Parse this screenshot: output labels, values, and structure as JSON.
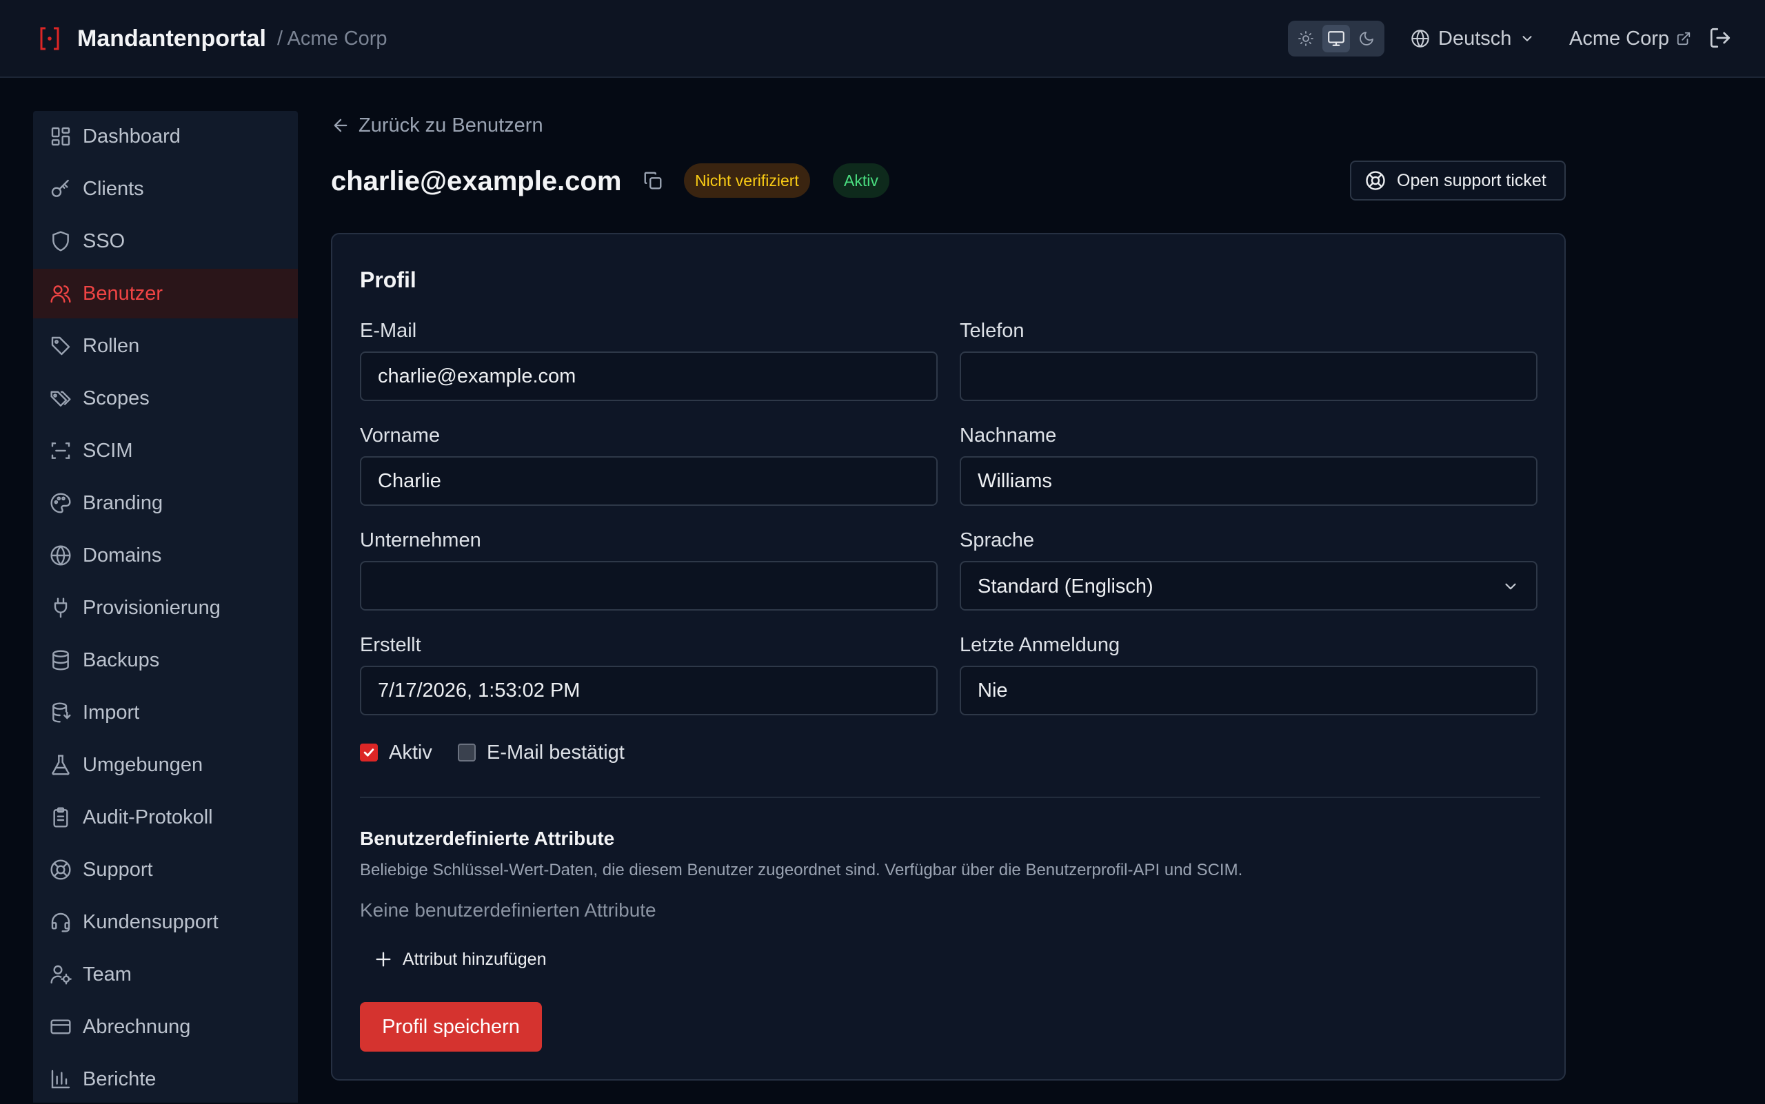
{
  "header": {
    "title": "Mandantenportal",
    "breadcrumb": "/ Acme Corp",
    "language": "Deutsch",
    "tenant": "Acme Corp"
  },
  "theme": {
    "modes": [
      "sun-icon",
      "monitor-icon",
      "moon-icon"
    ],
    "selected": "monitor-icon"
  },
  "colors": {
    "accent": "#dc2626",
    "badge_warning_text": "#facc15",
    "badge_success_text": "#4ade80"
  },
  "sidebar": {
    "items": [
      {
        "label": "Dashboard",
        "icon": "dashboard-icon"
      },
      {
        "label": "Clients",
        "icon": "key-icon"
      },
      {
        "label": "SSO",
        "icon": "shield-icon"
      },
      {
        "label": "Benutzer",
        "icon": "users-icon",
        "active": true
      },
      {
        "label": "Rollen",
        "icon": "tag-icon"
      },
      {
        "label": "Scopes",
        "icon": "tags-icon"
      },
      {
        "label": "SCIM",
        "icon": "scan-icon"
      },
      {
        "label": "Branding",
        "icon": "palette-icon"
      },
      {
        "label": "Domains",
        "icon": "globe-icon"
      },
      {
        "label": "Provisionierung",
        "icon": "plug-icon"
      },
      {
        "label": "Backups",
        "icon": "database-icon"
      },
      {
        "label": "Import",
        "icon": "database-import-icon"
      },
      {
        "label": "Umgebungen",
        "icon": "flask-icon"
      },
      {
        "label": "Audit-Protokoll",
        "icon": "clipboard-icon"
      },
      {
        "label": "Support",
        "icon": "lifebuoy-icon"
      },
      {
        "label": "Kundensupport",
        "icon": "headset-icon"
      },
      {
        "label": "Team",
        "icon": "user-cog-icon"
      },
      {
        "label": "Abrechnung",
        "icon": "credit-card-icon"
      },
      {
        "label": "Berichte",
        "icon": "bar-chart-icon"
      }
    ]
  },
  "main": {
    "back_label": "Zurück zu Benutzern",
    "title": "charlie@example.com",
    "badges": {
      "unverified": "Nicht verifiziert",
      "active": "Aktiv"
    },
    "support_button": "Open support ticket"
  },
  "profile": {
    "section_title": "Profil",
    "email": {
      "label": "E-Mail",
      "value": "charlie@example.com"
    },
    "phone": {
      "label": "Telefon",
      "value": ""
    },
    "first_name": {
      "label": "Vorname",
      "value": "Charlie"
    },
    "last_name": {
      "label": "Nachname",
      "value": "Williams"
    },
    "company": {
      "label": "Unternehmen",
      "value": ""
    },
    "language": {
      "label": "Sprache",
      "value": "Standard (Englisch)"
    },
    "created": {
      "label": "Erstellt",
      "value": "7/17/2026, 1:53:02 PM"
    },
    "last_login": {
      "label": "Letzte Anmeldung",
      "value": "Nie"
    },
    "active_checkbox": {
      "label": "Aktiv",
      "checked": true
    },
    "email_verified_checkbox": {
      "label": "E-Mail bestätigt",
      "checked": false
    },
    "custom_attributes": {
      "title": "Benutzerdefinierte Attribute",
      "description": "Beliebige Schlüssel-Wert-Daten, die diesem Benutzer zugeordnet sind. Verfügbar über die Benutzerprofil-API und SCIM.",
      "empty": "Keine benutzerdefinierten Attribute",
      "add_button": "Attribut hinzufügen"
    },
    "save_button": "Profil speichern"
  }
}
